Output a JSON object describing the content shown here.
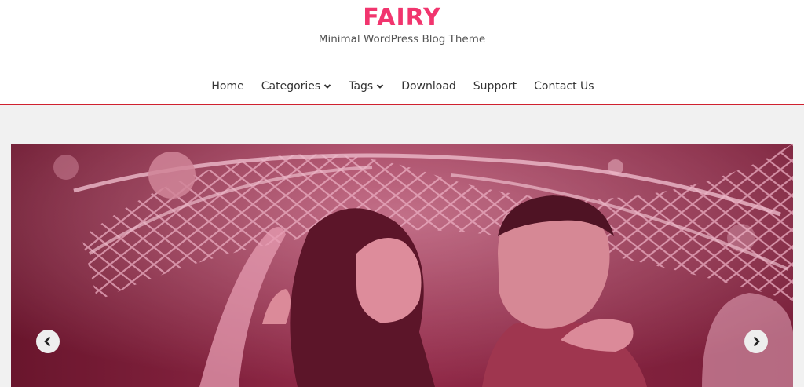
{
  "site": {
    "title": "FAIRY",
    "tagline": "Minimal WordPress Blog Theme"
  },
  "nav": {
    "items": [
      {
        "label": "Home",
        "has_dropdown": false
      },
      {
        "label": "Categories",
        "has_dropdown": true
      },
      {
        "label": "Tags",
        "has_dropdown": true
      },
      {
        "label": "Download",
        "has_dropdown": false
      },
      {
        "label": "Support",
        "has_dropdown": false
      },
      {
        "label": "Contact Us",
        "has_dropdown": false
      }
    ],
    "dropdown_icon": "chevron-down-icon"
  },
  "slider": {
    "image": "couple-under-lights-photo",
    "prev_icon": "chevron-left-icon",
    "next_icon": "chevron-right-icon"
  },
  "colors": {
    "brand": "#f1356e",
    "nav_border": "#d0212f",
    "overlay": "#b42850"
  }
}
